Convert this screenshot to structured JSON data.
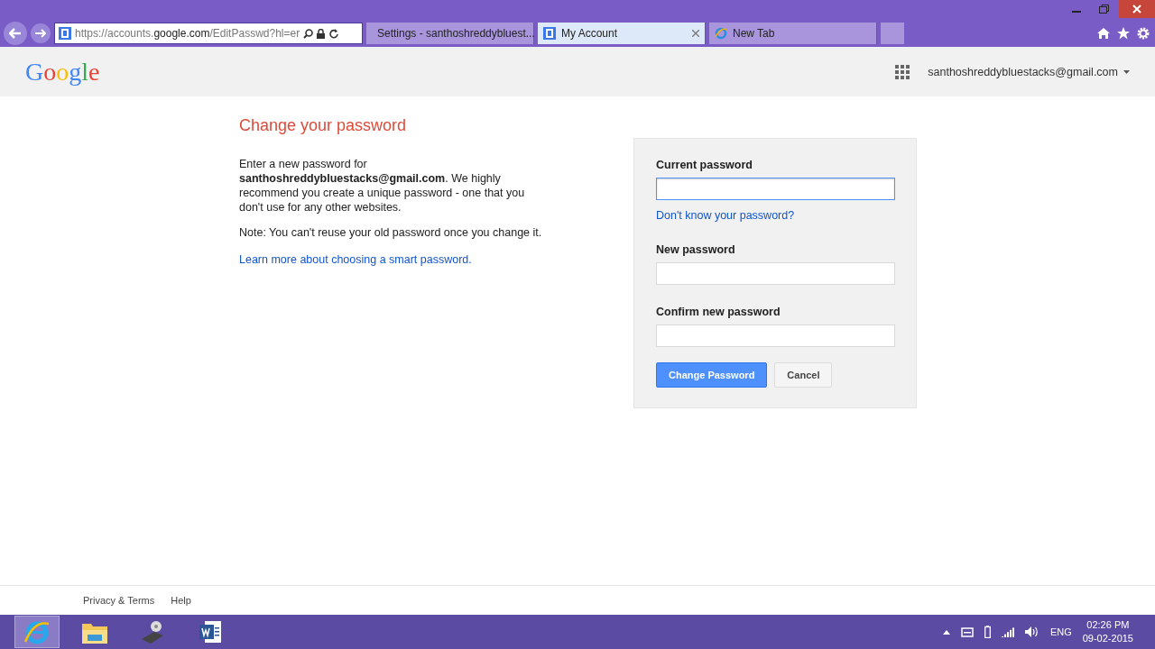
{
  "browser": {
    "address": {
      "prefix": "https://accounts.",
      "domain": "google.com",
      "path": "/EditPasswd?hl=er"
    },
    "tabs": [
      {
        "label": "Settings - santhoshreddybluest...",
        "selected": false
      },
      {
        "label": "My Account",
        "selected": true
      },
      {
        "label": "New Tab",
        "selected": false
      }
    ]
  },
  "header": {
    "logo": "Google",
    "account": "santhoshreddybluestacks@gmail.com"
  },
  "intro": {
    "title": "Change your password",
    "text": "Enter a new password for **santhoshreddybluestacks@gmail.com**. We highly recommend you create a unique password - one that you don't use for any other websites.",
    "note": "Note: You can't reuse your old password once you change it.",
    "link": "Learn more about choosing a smart password."
  },
  "form": {
    "fields": [
      {
        "label": "Current password",
        "focused": true,
        "help": "Don't know your password?"
      },
      {
        "label": "New password",
        "focused": false
      },
      {
        "label": "Confirm new password",
        "focused": false
      }
    ],
    "submit": "Change Password",
    "cancel": "Cancel"
  },
  "footer": [
    "Privacy & Terms",
    "Help"
  ],
  "taskbar": {
    "apps": [
      {
        "kind": "ie",
        "selected": true
      },
      {
        "kind": "folder",
        "selected": false
      },
      {
        "kind": "tool",
        "selected": false
      },
      {
        "kind": "word",
        "selected": false
      }
    ],
    "language": "ENG",
    "time": "02:26 PM",
    "date": "09-02-2015"
  }
}
